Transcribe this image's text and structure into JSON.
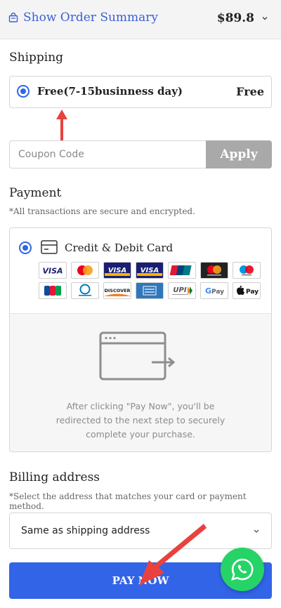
{
  "summary": {
    "toggle_label": "Show Order Summary",
    "total": "$89.8",
    "icon": "bag-icon",
    "accent": "#3b5fd6"
  },
  "shipping": {
    "title": "Shipping",
    "option_label": "Free(7-15businness day)",
    "option_price": "Free"
  },
  "coupon": {
    "placeholder": "Coupon Code",
    "apply_label": "Apply"
  },
  "payment": {
    "title": "Payment",
    "note": "*All transactions are secure and encrypted.",
    "option_label": "Credit & Debit Card",
    "logos": [
      "VISA",
      "Mastercard",
      "VISA",
      "VISA",
      "UnionPay",
      "Mastercard",
      "Maestro",
      "JCB",
      "Diners Club",
      "DISCOVER",
      "AMEX",
      "UPI",
      "G Pay",
      "Apple Pay"
    ],
    "redirect_text": "After clicking \"Pay Now\", you'll be redirected to the next step to securely complete your purchase."
  },
  "billing": {
    "title": "Billing address",
    "note": "*Select the address that matches your card or payment method.",
    "selected": "Same as shipping address"
  },
  "pay_now_label": "PAY NOW",
  "colors": {
    "primary": "#3264e8",
    "annotation_arrow": "#e8423f",
    "whatsapp": "#25d366"
  }
}
